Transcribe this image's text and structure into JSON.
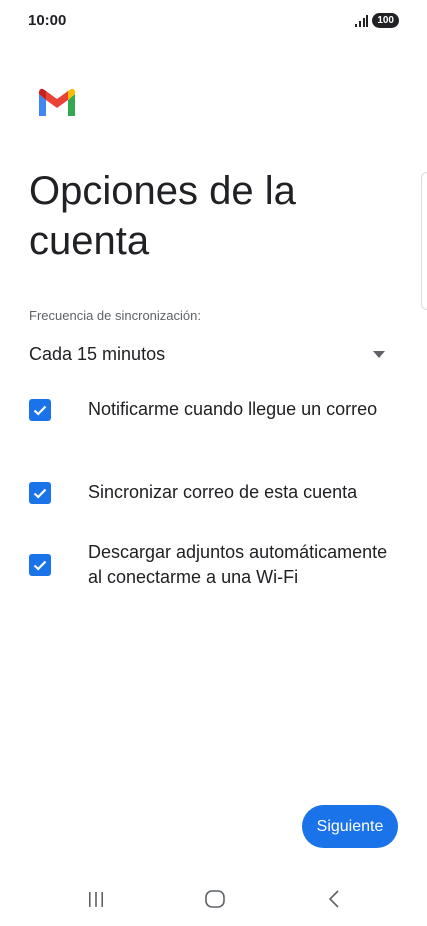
{
  "status_bar": {
    "time": "10:00",
    "battery": "100"
  },
  "icons": {
    "logo": "gmail-logo",
    "signal": "signal-icon",
    "dropdown": "dropdown-arrow-icon",
    "check": "check-icon",
    "recents": "recents-icon",
    "home": "home-icon",
    "back": "back-icon"
  },
  "page": {
    "title": "Opciones de la cuenta"
  },
  "sync": {
    "label": "Frecuencia de sincronización:",
    "selected": "Cada 15 minutos"
  },
  "options": [
    {
      "label": "Notificarme cuando llegue un correo",
      "checked": true
    },
    {
      "label": "Sincronizar correo de esta cuenta",
      "checked": true
    },
    {
      "label": "Descargar adjuntos automáticamente al conectarme a una Wi-Fi",
      "checked": true
    }
  ],
  "actions": {
    "next_label": "Siguiente"
  },
  "colors": {
    "accent": "#1a73e8",
    "text": "#202124",
    "secondary_text": "#5f6368"
  }
}
